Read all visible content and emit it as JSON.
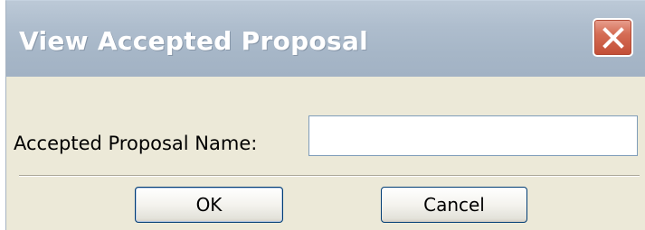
{
  "dialog": {
    "title": "View Accepted Proposal",
    "close_icon": "close-icon",
    "field": {
      "label": "Accepted Proposal Name:",
      "value": "",
      "placeholder": ""
    },
    "buttons": {
      "ok_label": "OK",
      "cancel_label": "Cancel"
    }
  },
  "colors": {
    "title_bar": "#aebdcd",
    "close_button": "#d56d55",
    "dialog_background": "#ece9d8",
    "input_border": "#7f9db9",
    "button_border": "#003c74"
  }
}
